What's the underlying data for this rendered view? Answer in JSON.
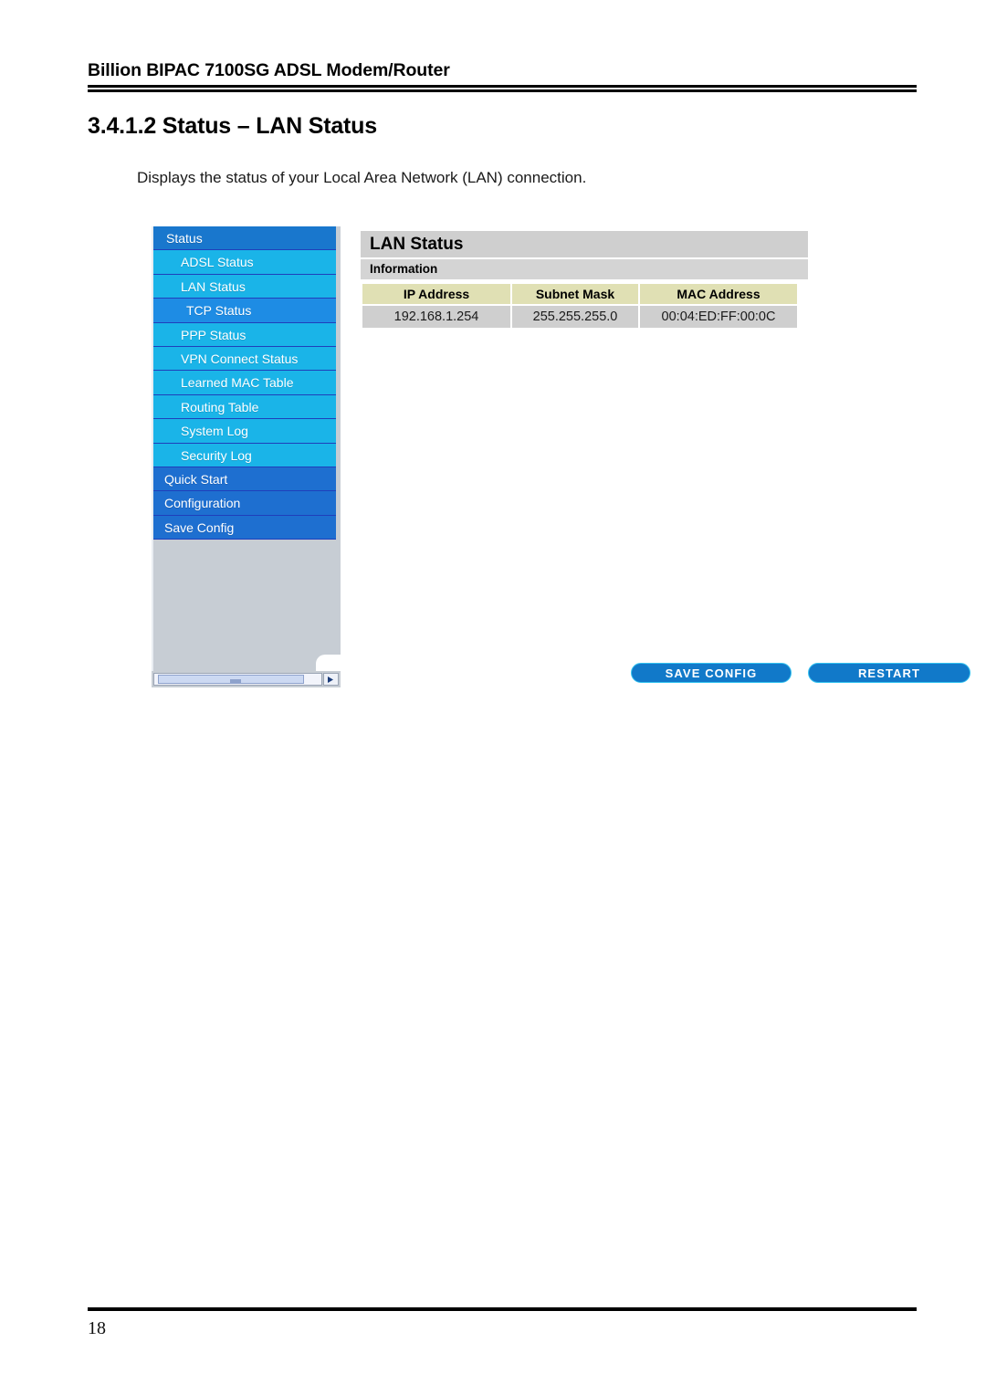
{
  "document": {
    "running_head": "Billion BIPAC 7100SG ADSL Modem/Router",
    "section_heading": "3.4.1.2 Status – LAN Status",
    "paragraph": "Displays the status of your Local Area Network (LAN) connection.",
    "page_number": "18"
  },
  "screenshot": {
    "sidebar": {
      "items": [
        {
          "label": "Status",
          "level": "top",
          "state": "normal"
        },
        {
          "label": "ADSL Status",
          "level": "sub",
          "state": "normal"
        },
        {
          "label": "LAN Status",
          "level": "sub",
          "state": "normal"
        },
        {
          "label": "TCP Status",
          "level": "sub",
          "state": "active"
        },
        {
          "label": "PPP Status",
          "level": "sub",
          "state": "normal"
        },
        {
          "label": "VPN Connect Status",
          "level": "sub",
          "state": "normal"
        },
        {
          "label": "Learned MAC Table",
          "level": "sub",
          "state": "normal"
        },
        {
          "label": "Routing Table",
          "level": "sub",
          "state": "normal"
        },
        {
          "label": "System Log",
          "level": "sub",
          "state": "normal"
        },
        {
          "label": "Security Log",
          "level": "sub",
          "state": "normal"
        },
        {
          "label": "Quick Start",
          "level": "sec",
          "state": "normal"
        },
        {
          "label": "Configuration",
          "level": "sec",
          "state": "normal"
        },
        {
          "label": "Save Config",
          "level": "sec",
          "state": "normal"
        }
      ],
      "scrollbar": {
        "icon": "scroll-right-arrow-icon"
      }
    },
    "panel": {
      "title": "LAN Status",
      "subtitle": "Information",
      "table": {
        "headers": [
          "IP Address",
          "Subnet Mask",
          "MAC Address"
        ],
        "rows": [
          [
            "192.168.1.254",
            "255.255.255.0",
            "00:04:ED:FF:00:0C"
          ]
        ]
      },
      "buttons": {
        "save_config": "SAVE CONFIG",
        "restart": "RESTART"
      }
    },
    "colors": {
      "menu_top": "#1977cd",
      "menu_sub": "#1ab4e8",
      "menu_sub_active": "#1e8ce4",
      "menu_section": "#1e6fd0",
      "sidebar_bg": "#c7cdd4",
      "panel_title_bg": "#cfcfcf",
      "panel_subtitle_bg": "#d4d4d4",
      "table_header_bg": "#e0e0b4",
      "table_cell_bg": "#cfcfcf",
      "button_bg": "#1179c9",
      "button_border": "#35c3f0"
    }
  }
}
